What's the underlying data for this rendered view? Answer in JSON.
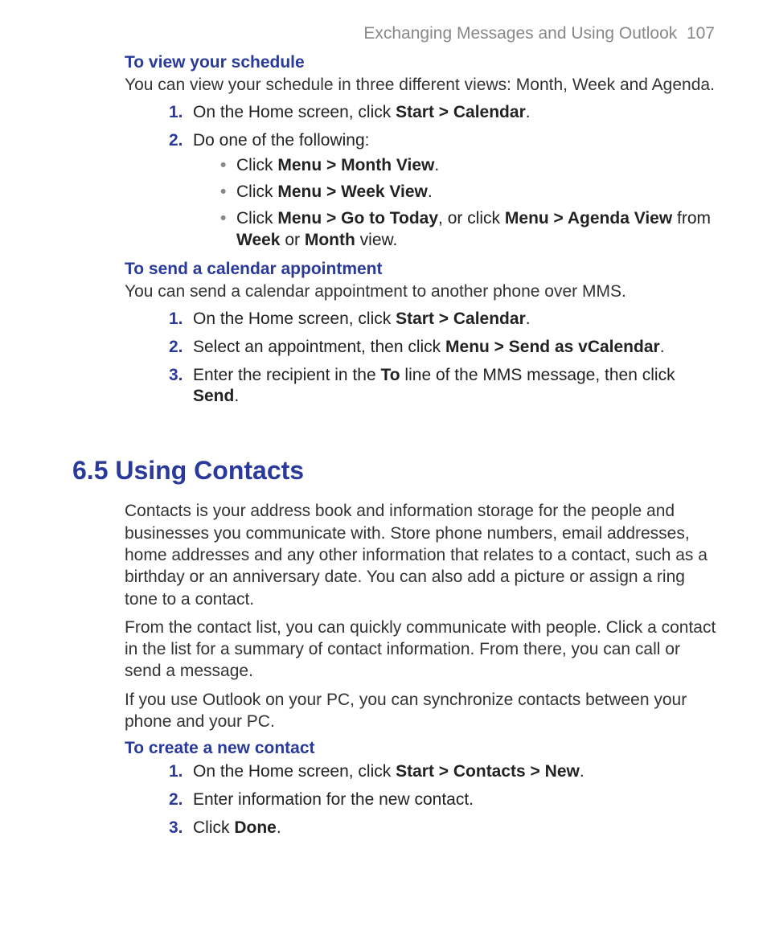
{
  "header": {
    "title": "Exchanging Messages and Using Outlook",
    "page_number": "107"
  },
  "section_view_schedule": {
    "heading": "To view your schedule",
    "intro": "You can view your schedule in three different views: Month, Week and Agenda.",
    "step1_pre": "On the Home screen, click ",
    "step1_bold": "Start > Calendar",
    "step1_post": ".",
    "step2": "Do one of the following:",
    "bullet1_pre": "Click ",
    "bullet1_bold": "Menu > Month View",
    "bullet1_post": ".",
    "bullet2_pre": "Click ",
    "bullet2_bold": "Menu > Week View",
    "bullet2_post": ".",
    "bullet3_pre": "Click ",
    "bullet3_bold1": "Menu > Go to Today",
    "bullet3_mid": ", or click ",
    "bullet3_bold2": "Menu > Agenda View",
    "bullet3_post1": " from ",
    "bullet3_bold3": "Week",
    "bullet3_post2": " or ",
    "bullet3_bold4": "Month",
    "bullet3_post3": " view."
  },
  "section_send_appt": {
    "heading": "To send a calendar appointment",
    "intro": "You can send a calendar appointment to another phone over MMS.",
    "step1_pre": "On the Home screen, click ",
    "step1_bold": "Start > Calendar",
    "step1_post": ".",
    "step2_pre": "Select an appointment, then click ",
    "step2_bold": "Menu > Send as vCalendar",
    "step2_post": ".",
    "step3_pre": "Enter the recipient in the ",
    "step3_bold1": "To",
    "step3_mid": " line of the MMS message, then click ",
    "step3_bold2": "Send",
    "step3_post": "."
  },
  "section_contacts": {
    "title": "6.5 Using Contacts",
    "para1": "Contacts is your address book and information storage for the people and businesses you communicate with. Store phone numbers, email addresses, home addresses and any other information that relates to a contact, such as a birthday or an anniversary date. You can also add a picture or assign a ring tone to a contact.",
    "para2": "From the contact list, you can quickly communicate with people. Click a contact in the list for a summary of contact information. From there, you can call or send a message.",
    "para3": "If you use Outlook on your PC, you can synchronize contacts between your phone and your PC."
  },
  "section_create_contact": {
    "heading": "To create a new contact",
    "step1_pre": "On the Home screen, click ",
    "step1_bold": "Start > Contacts > New",
    "step1_post": ".",
    "step2": "Enter information for the new contact.",
    "step3_pre": "Click ",
    "step3_bold": "Done",
    "step3_post": "."
  },
  "markers": {
    "n1": "1.",
    "n2": "2.",
    "n3": "3."
  }
}
